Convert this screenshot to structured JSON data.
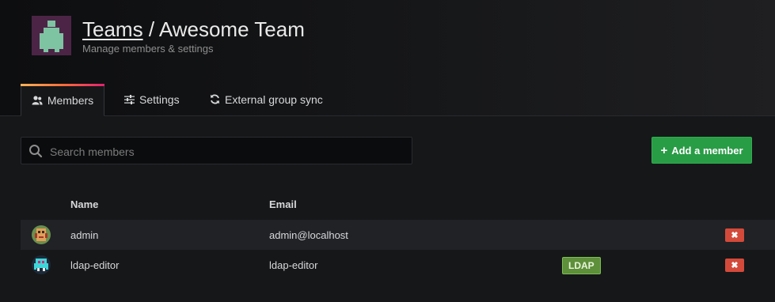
{
  "header": {
    "breadcrumb_link": "Teams",
    "breadcrumb_separator": "/",
    "title": "Awesome Team",
    "subtitle": "Manage members & settings",
    "avatar_icon": "team-avatar-icon"
  },
  "tabs": [
    {
      "label": "Members",
      "icon": "users-icon",
      "active": true
    },
    {
      "label": "Settings",
      "icon": "sliders-icon",
      "active": false
    },
    {
      "label": "External group sync",
      "icon": "sync-icon",
      "active": false
    }
  ],
  "search": {
    "placeholder": "Search members",
    "value": ""
  },
  "actions": {
    "add_member_label": "Add a member"
  },
  "table": {
    "columns": [
      "Name",
      "Email"
    ],
    "rows": [
      {
        "name": "admin",
        "email": "admin@localhost",
        "badge": "",
        "delete_label": "✖"
      },
      {
        "name": "ldap-editor",
        "email": "ldap-editor",
        "badge": "LDAP",
        "delete_label": "✖"
      }
    ]
  },
  "colors": {
    "accent_gradient": [
      "#ffb357",
      "#ff6d3a",
      "#e0226e"
    ],
    "add_button": "#299c46",
    "delete_button": "#d44a3a",
    "ldap_badge": "#5e8f3a"
  }
}
